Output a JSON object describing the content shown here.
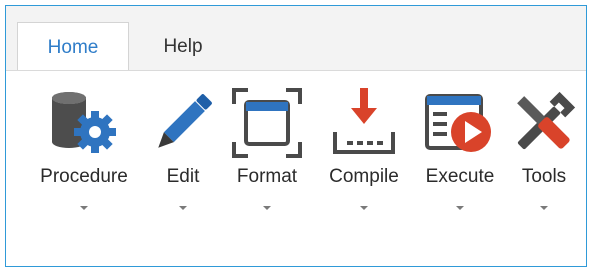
{
  "tabs": [
    {
      "label": "Home",
      "active": true
    },
    {
      "label": "Help",
      "active": false
    }
  ],
  "ribbon": {
    "buttons": [
      {
        "label": "Procedure",
        "icon": "procedure-gear-icon"
      },
      {
        "label": "Edit",
        "icon": "pencil-icon"
      },
      {
        "label": "Format",
        "icon": "format-frame-icon"
      },
      {
        "label": "Compile",
        "icon": "compile-download-icon"
      },
      {
        "label": "Execute",
        "icon": "execute-play-icon"
      },
      {
        "label": "Tools",
        "icon": "tools-icon"
      }
    ]
  },
  "colors": {
    "accent": "#2f7dc9",
    "icon_gray": "#4a4a4a",
    "icon_blue": "#2f74c0",
    "icon_red": "#d9432a"
  }
}
